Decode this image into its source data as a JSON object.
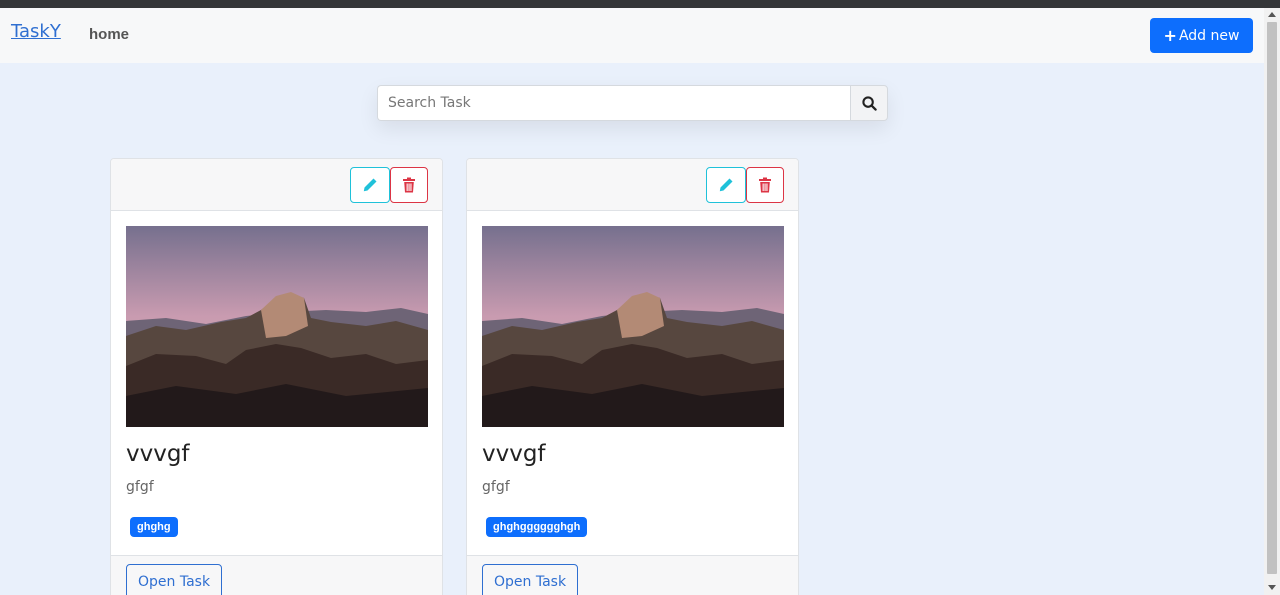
{
  "nav": {
    "brand": "TaskY",
    "home_label": "home",
    "add_button": {
      "icon": "plus-icon",
      "label": "Add new"
    }
  },
  "search": {
    "placeholder": "Search Task",
    "value": "",
    "button_icon": "search-icon"
  },
  "cards": [
    {
      "title": "vvvgf",
      "description": "gfgf",
      "tag": "ghghg",
      "open_label": "Open Task",
      "edit_icon": "pencil-icon",
      "delete_icon": "trash-icon",
      "image": "mountain-landscape-image"
    },
    {
      "title": "vvvgf",
      "description": "gfgf",
      "tag": "ghghgggggghgh",
      "open_label": "Open Task",
      "edit_icon": "pencil-icon",
      "delete_icon": "trash-icon",
      "image": "mountain-landscape-image"
    }
  ],
  "colors": {
    "primary": "#0d6efd",
    "brand_link": "#2f6fd1",
    "edit_border": "#1fc1d9",
    "delete_border": "#dc3545",
    "page_background": "#e9f0fb"
  }
}
